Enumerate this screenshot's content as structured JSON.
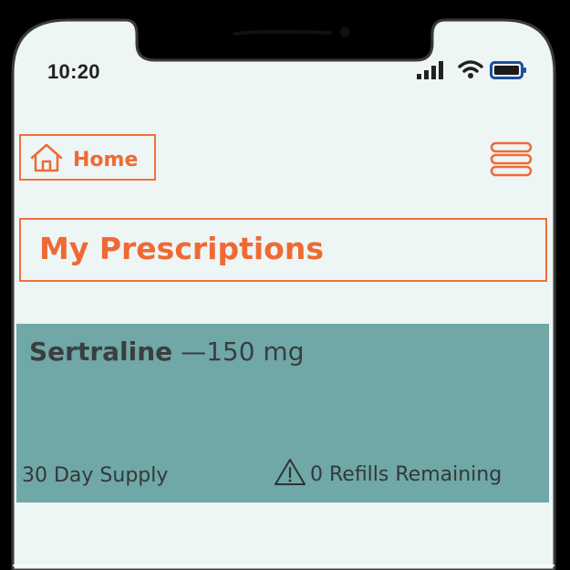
{
  "status_bar": {
    "time": "10:20",
    "icons": [
      "cellular-signal-icon",
      "wifi-icon",
      "battery-icon"
    ]
  },
  "header": {
    "home_label": "Home",
    "home_icon": "home-icon",
    "menu_icon": "hamburger-menu-icon"
  },
  "page": {
    "title": "My Prescriptions"
  },
  "prescriptions": [
    {
      "drug": "Sertraline",
      "separator": " —",
      "dose": "150 mg",
      "supply": "30 Day Supply",
      "refills": "0 Refills Remaining",
      "refills_icon": "warning-icon"
    }
  ],
  "colors": {
    "accent": "#ef6a33",
    "card": "#6fa8a6",
    "screen": "#eef5f5",
    "text_dark": "#33383a"
  }
}
